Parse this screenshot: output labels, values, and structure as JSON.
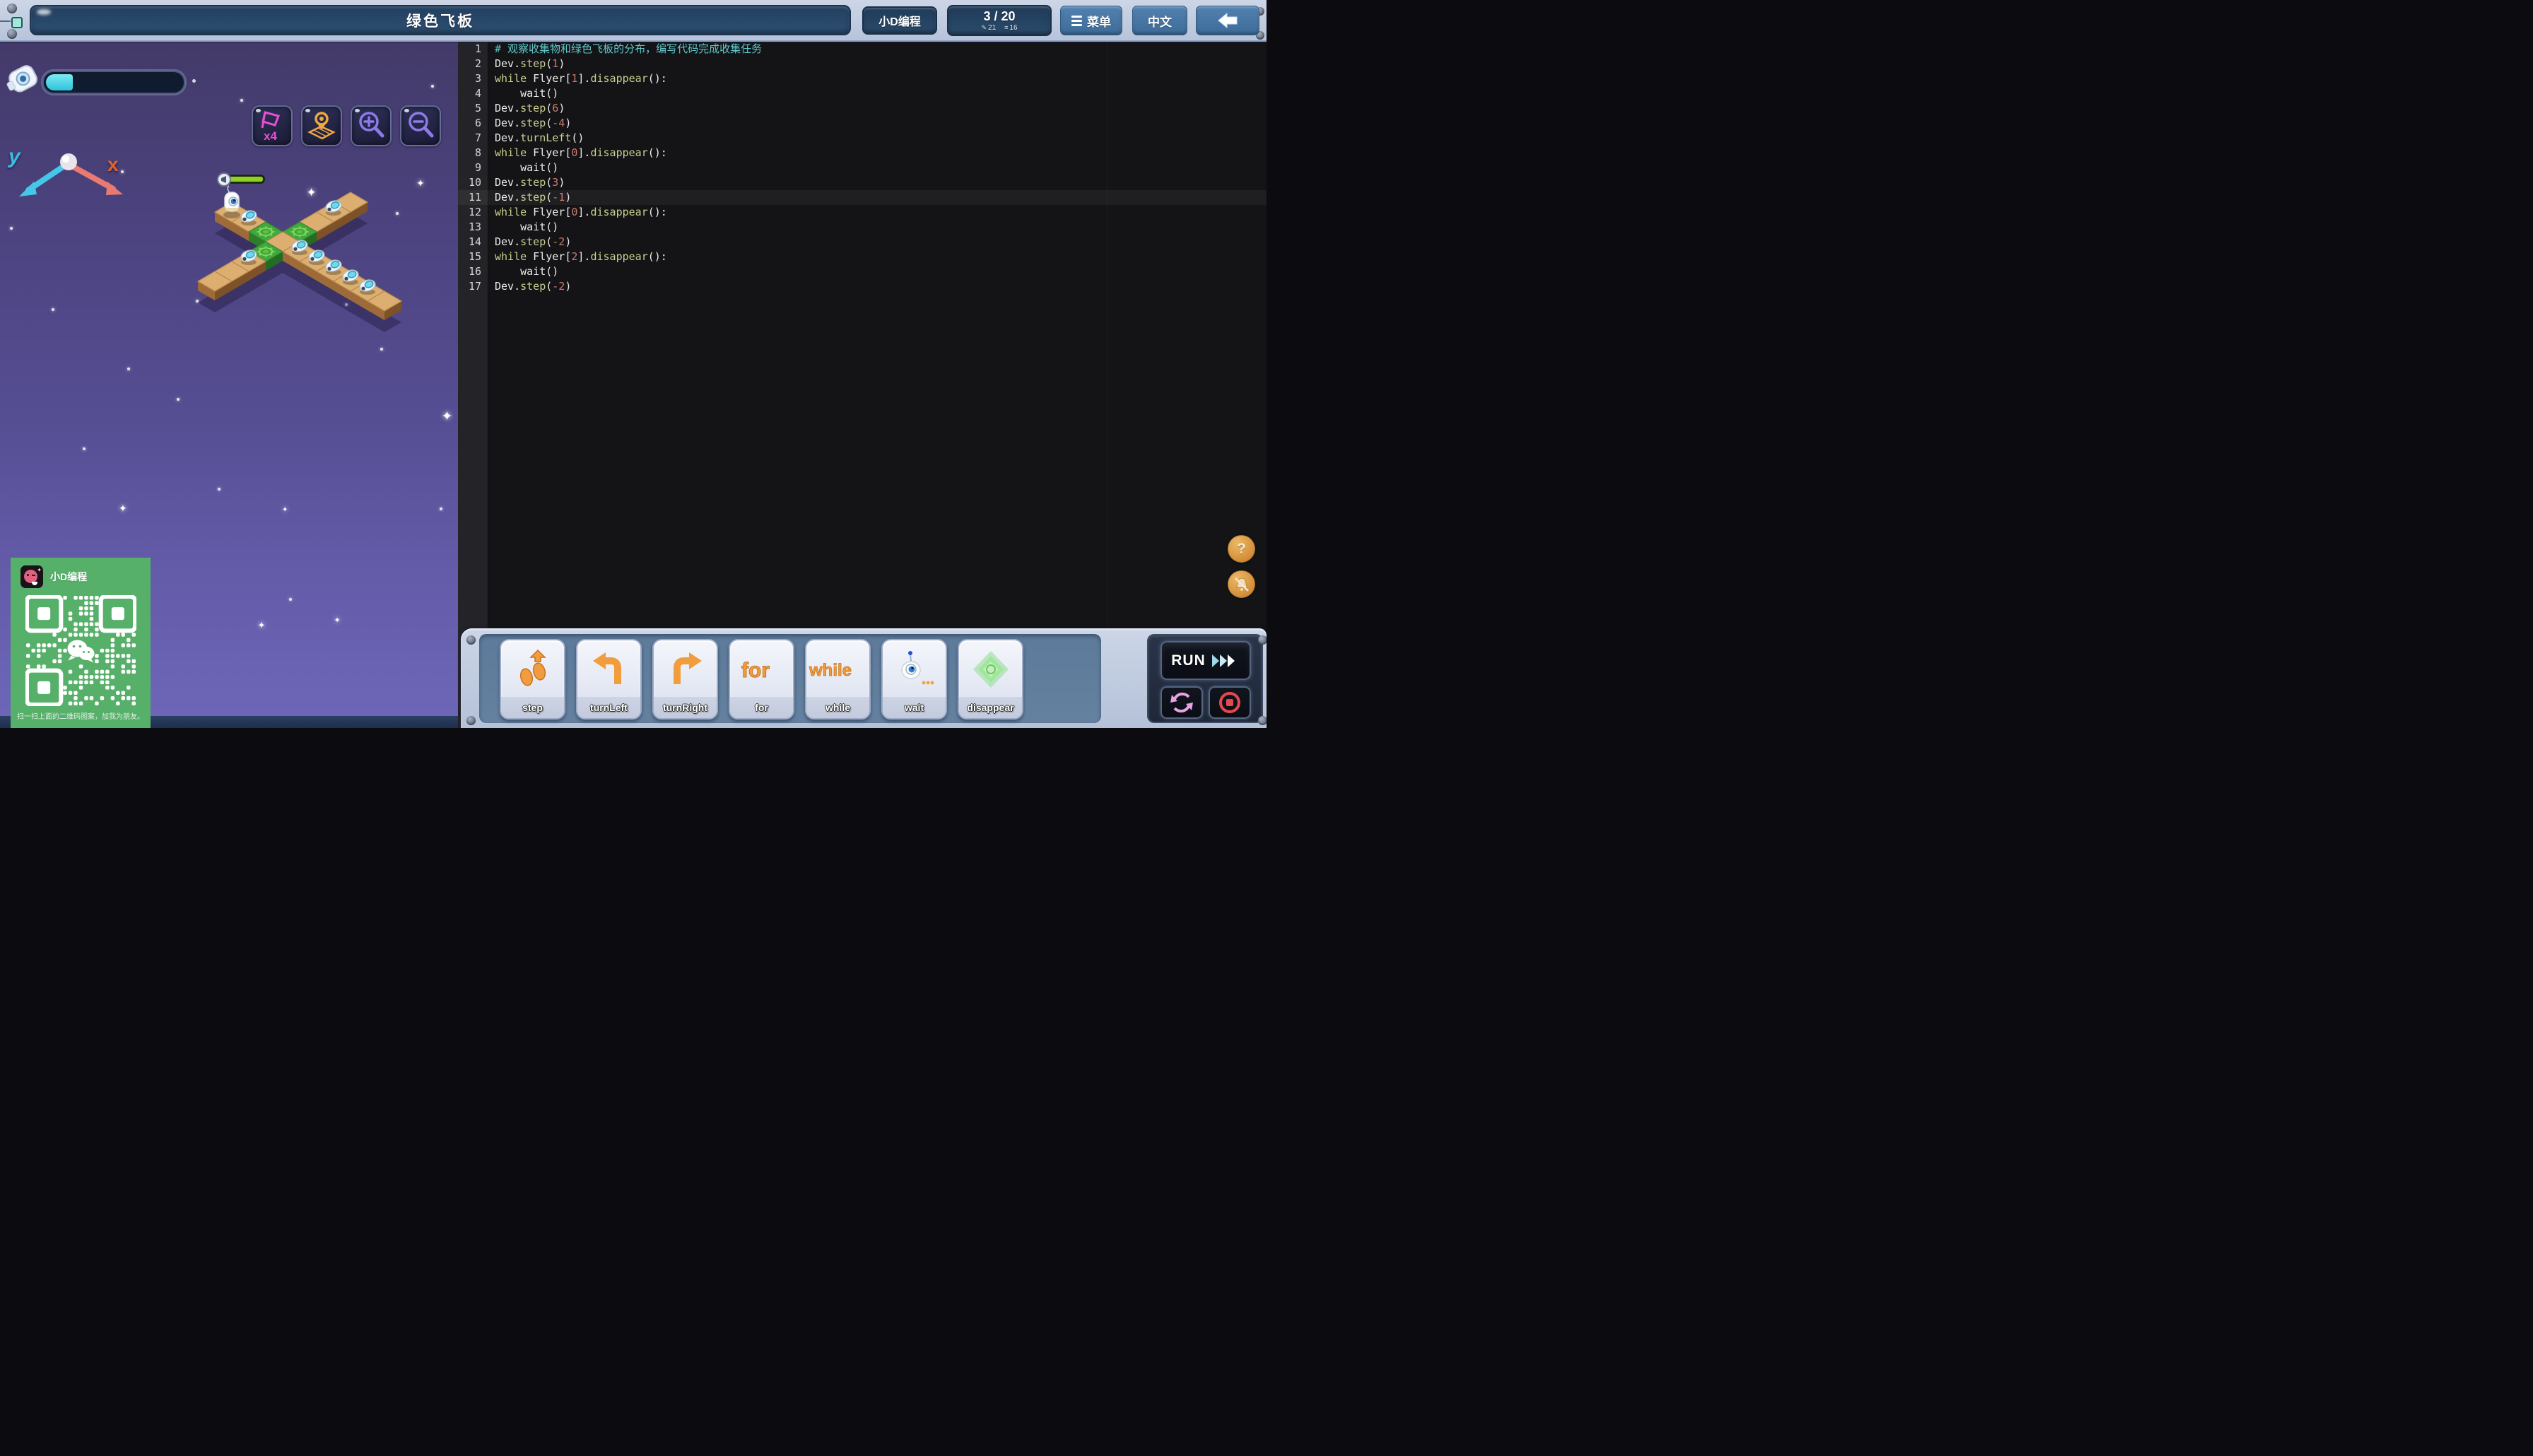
{
  "app": {
    "title": "绿色飞板",
    "brand": "小D编程",
    "menu": "菜单",
    "language": "中文",
    "level": {
      "display": "3 / 20",
      "edits": "21",
      "lines": "16"
    }
  },
  "game": {
    "axis_labels": {
      "x": "x",
      "y": "y"
    },
    "hud_progress_fraction": 0.2,
    "speed_badge": "x4",
    "board": {
      "arm_a_range": [
        -3,
        6
      ],
      "arm_b_range": [
        -4,
        4
      ],
      "green_tiles": [
        [
          "A",
          -1
        ],
        [
          "B",
          1
        ],
        [
          "B",
          -1
        ]
      ],
      "collectibles": [
        [
          "A",
          -2
        ],
        [
          "A",
          1
        ],
        [
          "A",
          2
        ],
        [
          "A",
          3
        ],
        [
          "A",
          4
        ],
        [
          "A",
          5
        ],
        [
          "B",
          3
        ],
        [
          "B",
          -2
        ]
      ],
      "character": [
        "A",
        -3
      ]
    }
  },
  "editor": {
    "current_line": 11,
    "lines": [
      {
        "n": 1,
        "tokens": [
          [
            "c",
            "# 观察收集物和绿色飞板的分布，编写代码完成收集任务"
          ]
        ]
      },
      {
        "n": 2,
        "tokens": [
          [
            "p",
            "Dev."
          ],
          [
            "k",
            "step"
          ],
          [
            "p",
            "("
          ],
          [
            "n",
            "1"
          ],
          [
            "p",
            ")"
          ]
        ]
      },
      {
        "n": 3,
        "tokens": [
          [
            "k",
            "while"
          ],
          [
            "p",
            " Flyer["
          ],
          [
            "n",
            "1"
          ],
          [
            "p",
            "]."
          ],
          [
            "k",
            "disappear"
          ],
          [
            "p",
            "():"
          ]
        ]
      },
      {
        "n": 4,
        "tokens": [
          [
            "p",
            "    wait()"
          ]
        ]
      },
      {
        "n": 5,
        "tokens": [
          [
            "p",
            "Dev."
          ],
          [
            "k",
            "step"
          ],
          [
            "p",
            "("
          ],
          [
            "n",
            "6"
          ],
          [
            "p",
            ")"
          ]
        ]
      },
      {
        "n": 6,
        "tokens": [
          [
            "p",
            "Dev."
          ],
          [
            "k",
            "step"
          ],
          [
            "p",
            "("
          ],
          [
            "n",
            "-4"
          ],
          [
            "p",
            ")"
          ]
        ]
      },
      {
        "n": 7,
        "tokens": [
          [
            "p",
            "Dev."
          ],
          [
            "k",
            "turnLeft"
          ],
          [
            "p",
            "()"
          ]
        ]
      },
      {
        "n": 8,
        "tokens": [
          [
            "k",
            "while"
          ],
          [
            "p",
            " Flyer["
          ],
          [
            "n",
            "0"
          ],
          [
            "p",
            "]."
          ],
          [
            "k",
            "disappear"
          ],
          [
            "p",
            "():"
          ]
        ]
      },
      {
        "n": 9,
        "tokens": [
          [
            "p",
            "    wait()"
          ]
        ]
      },
      {
        "n": 10,
        "tokens": [
          [
            "p",
            "Dev."
          ],
          [
            "k",
            "step"
          ],
          [
            "p",
            "("
          ],
          [
            "n",
            "3"
          ],
          [
            "p",
            ")"
          ]
        ]
      },
      {
        "n": 11,
        "tokens": [
          [
            "p",
            "Dev."
          ],
          [
            "k",
            "step"
          ],
          [
            "p",
            "("
          ],
          [
            "n",
            "-1"
          ],
          [
            "p",
            ")"
          ]
        ]
      },
      {
        "n": 12,
        "tokens": [
          [
            "k",
            "while"
          ],
          [
            "p",
            " Flyer["
          ],
          [
            "n",
            "0"
          ],
          [
            "p",
            "]."
          ],
          [
            "k",
            "disappear"
          ],
          [
            "p",
            "():"
          ]
        ]
      },
      {
        "n": 13,
        "tokens": [
          [
            "p",
            "    wait()"
          ]
        ]
      },
      {
        "n": 14,
        "tokens": [
          [
            "p",
            "Dev."
          ],
          [
            "k",
            "step"
          ],
          [
            "p",
            "("
          ],
          [
            "n",
            "-2"
          ],
          [
            "p",
            ")"
          ]
        ]
      },
      {
        "n": 15,
        "tokens": [
          [
            "k",
            "while"
          ],
          [
            "p",
            " Flyer["
          ],
          [
            "n",
            "2"
          ],
          [
            "p",
            "]."
          ],
          [
            "k",
            "disappear"
          ],
          [
            "p",
            "():"
          ]
        ]
      },
      {
        "n": 16,
        "tokens": [
          [
            "p",
            "    wait()"
          ]
        ]
      },
      {
        "n": 17,
        "tokens": [
          [
            "p",
            "Dev."
          ],
          [
            "k",
            "step"
          ],
          [
            "p",
            "("
          ],
          [
            "n",
            "-2"
          ],
          [
            "p",
            ")"
          ]
        ]
      }
    ]
  },
  "toolbar": {
    "run": "RUN",
    "commands": [
      {
        "id": "step",
        "label": "step"
      },
      {
        "id": "turnLeft",
        "label": "turnLeft"
      },
      {
        "id": "turnRight",
        "label": "turnRight"
      },
      {
        "id": "for",
        "label": "for"
      },
      {
        "id": "while",
        "label": "while"
      },
      {
        "id": "wait",
        "label": "wait"
      },
      {
        "id": "disappear",
        "label": "disappear"
      }
    ]
  },
  "qr": {
    "app_name": "小D编程",
    "caption": "扫一扫上面的二维码图案，加我为朋友。"
  },
  "colors": {
    "accent_orange": "#f09b3c",
    "accent_green": "#41a83e",
    "run_red": "#e5484d",
    "reset_pink": "#e7a2e3",
    "comment": "#5fc8cc",
    "keyword": "#cbcf8f",
    "number": "#cd7a6e",
    "speed_magenta": "#e54fd0",
    "zoom_purple": "#8d7ae8",
    "map_orange": "#eda83f"
  }
}
